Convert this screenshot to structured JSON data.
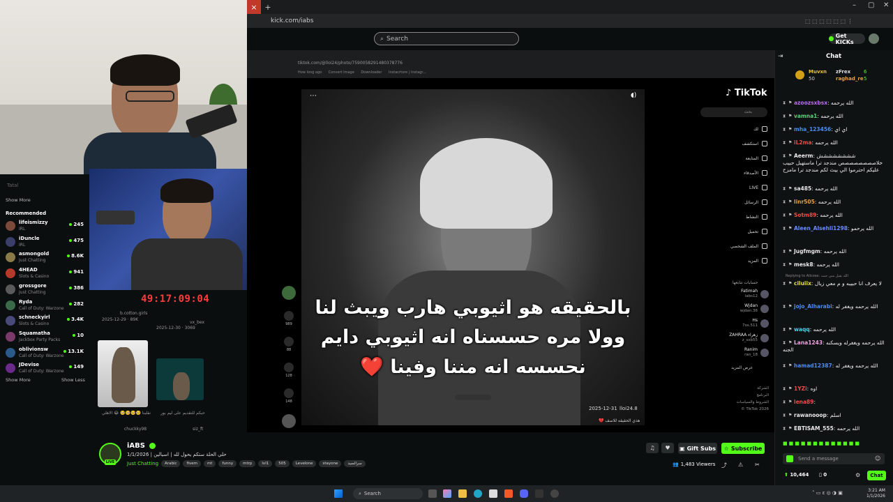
{
  "browser": {
    "url": "kick.com/iabs",
    "inner_url": "tiktok.com/@lloi24/photo/7590058291480378776",
    "bookmarks": [
      "How long ago",
      "Convert Image",
      "Downloader",
      "Instacrtore | Instagr..."
    ]
  },
  "kick_header": {
    "search_placeholder": "Search",
    "get_kicks_label": "Get KICKs"
  },
  "sidebar": {
    "top_item": "Tatal",
    "show_more_1": "Show More",
    "recommended_label": "Recommended",
    "recommended": [
      {
        "name": "lifeismizzy",
        "category": "IRL",
        "viewers": "245",
        "color": "#7a4b3a"
      },
      {
        "name": "iDuncle",
        "category": "IRL",
        "viewers": "475",
        "color": "#3a3f6a"
      },
      {
        "name": "asmongold",
        "category": "Just Chatting",
        "viewers": "8.6K",
        "color": "#8a7a4a"
      },
      {
        "name": "4HEAD",
        "category": "Slots & Casino",
        "viewers": "941",
        "color": "#b63a2a"
      },
      {
        "name": "grossgore",
        "category": "Just Chatting",
        "viewers": "386",
        "color": "#5a5a5a"
      },
      {
        "name": "Ryda",
        "category": "Call of Duty: Warzone",
        "viewers": "282",
        "color": "#3a6a4a"
      },
      {
        "name": "schneckyirl",
        "category": "Slots & Casino",
        "viewers": "3.4K",
        "color": "#4a4a7a"
      },
      {
        "name": "Squamatha",
        "category": "Jackbox Party Packs",
        "viewers": "10",
        "color": "#7a3a6a"
      },
      {
        "name": "oblivionsw",
        "category": "Call of Duty: Warzone",
        "viewers": "13.1K",
        "color": "#2a5a8a"
      },
      {
        "name": "JDevise",
        "category": "Call of Duty: Warzone",
        "viewers": "149",
        "color": "#6a2a8a"
      }
    ],
    "show_more_2": "Show More",
    "show_less": "Show Less"
  },
  "overlay": {
    "timer": "49:17:09:04"
  },
  "tiktok": {
    "logo": "TikTok",
    "search_placeholder": "بحث",
    "nav": [
      "لك",
      "استكشف",
      "المتابعة",
      "الأصدقاء",
      "LIVE",
      "الرسائل",
      "النشاط",
      "تحميل",
      "الملف الشخصي",
      "المزيد"
    ],
    "following_label": "حسابات تتابعها",
    "following": [
      {
        "name": "Fatimah",
        "handle": "iabs12"
      },
      {
        "name": "Wjdan",
        "handle": "wjdan.36"
      },
      {
        "name": "Hs",
        "handle": "7os.511"
      },
      {
        "name": "ZAHRAA زهراء",
        "handle": "z_sxb55"
      },
      {
        "name": "Ranim",
        "handle": "ran_18"
      }
    ],
    "see_more": "عرض المزيد",
    "footer": [
      "الشركة",
      "البرنامج",
      "الشروط والسياسات",
      "TikTok 2026 ©"
    ],
    "subtitle_lines": [
      "بالحقيقه هو اثيوبي هارب ويبث لنا",
      "وولا مره حسسناه انه اثيوبي دايم",
      "نحسسه انه مننا وفينا ❤️"
    ],
    "video_date": "2025-12-31",
    "video_author": "lloi24.8",
    "video_caption": "هذي الحقيقه للاسف 💔",
    "actions": [
      {
        "icon": "heart-icon",
        "count": "989"
      },
      {
        "icon": "comment-icon",
        "count": "88"
      },
      {
        "icon": "bookmark-icon",
        "count": "128"
      },
      {
        "icon": "share-icon",
        "count": "148"
      }
    ],
    "grid_meta_1": "b.cotton.girls",
    "grid_meta_2": "2025-12-29 · 89K",
    "grid_meta_3": "vx_bex",
    "grid_meta_4": "2025-12-30 · 3069",
    "grid_meta_5": "chuckky98",
    "grid_meta_6": "siz_ft",
    "grid_caption_1": "انقلبنا 🥺🥺🥺🥺 😂 الاهلي...",
    "grid_caption_2": "مشترين السعودية 💚 حبكم للتقديم على ليم بور..."
  },
  "stream": {
    "name": "iABS",
    "title": "حلي الحلة ستكم يحول لله | اسيالين | 1/1/2026",
    "category": "Just Chatting",
    "tags": [
      "Arabic",
      "fivem",
      "mt",
      "funny",
      "mtrp",
      "lvl1",
      "505",
      "Levelone",
      "stayone",
      "سرالسيد"
    ],
    "gift_subs_label": "Gift Subs",
    "subscribe_label": "Subscribe",
    "viewers": "1,483 Viewers"
  },
  "chat": {
    "title": "Chat",
    "gifters": [
      {
        "name": "Muvxn",
        "count": "50"
      },
      {
        "name": "zFrex",
        "count": "6"
      },
      {
        "name": "raghad_re",
        "count": "5"
      }
    ],
    "messages": [
      {
        "user": "azoozsxbsx",
        "color": "#b86cf0",
        "text": "الله يرحمه"
      },
      {
        "user": "vamna1",
        "color": "#5ad07a",
        "text": "الله يرحمه"
      },
      {
        "user": "mha_123456",
        "color": "#4a8cf0",
        "text": "اي اي"
      },
      {
        "user": "iL2ma",
        "color": "#f04a4a",
        "text": "الله يرحمه"
      },
      {
        "user": "Aeerm",
        "color": "#e8e8e8",
        "text": "شششششششش خلاصصصصصصصص مندجد ترا ماستهبل حبيب عليكم احترموا الي بيث لكم مندجد ترا مامزح"
      },
      {
        "user": "sa485",
        "color": "#e8e8e8",
        "text": "الله يرحمه"
      },
      {
        "user": "linr505",
        "color": "#e8a040",
        "text": "الله يرحمه"
      },
      {
        "user": "Sotm89",
        "color": "#f04a4a",
        "text": "الله يرحمه"
      },
      {
        "user": "Aleen_Alsehli1298",
        "color": "#6a8cff",
        "text": "الله يرحمو"
      },
      {
        "user": "Jugfmgm",
        "color": "#e8e8e8",
        "text": "الله يرحمه"
      },
      {
        "user": "mesk8",
        "color": "#e8e8e8",
        "text": "الله يرحمه"
      },
      {
        "user": "ciluiix",
        "color": "#e8e040",
        "text": "لا يعرف انا حبيبه و م معي زيال"
      },
      {
        "user": "jojo_Alharabi",
        "color": "#4a8cf0",
        "text": "الله يرحمه ويغفر له"
      },
      {
        "user": "waqq",
        "color": "#4ad0f0",
        "text": "الله يرحمه"
      },
      {
        "user": "Lana1243",
        "color": "#f0a0e0",
        "text": "الله يرحمه ويغفرله ويسكنه الجنه"
      },
      {
        "user": "hamad12387",
        "color": "#4a8cf0",
        "text": "الله يرحمه ويغفر له"
      },
      {
        "user": "1YZi",
        "color": "#f04a4a",
        "text": "اوه"
      },
      {
        "user": "lena89",
        "color": "#f04a4a",
        "text": ""
      },
      {
        "user": "rawanooop",
        "color": "#e8e8e8",
        "text": "اسلم"
      },
      {
        "user": "EBTISAM_555",
        "color": "#e8e8e8",
        "text": "الله يرحمه"
      }
    ],
    "replying_to": "Replying to Alicose: الله يقبل مني جبت",
    "send_placeholder": "Send a message",
    "points": "10,464",
    "zero": "0",
    "chat_button": "Chat"
  },
  "taskbar": {
    "search_label": "Search",
    "time": "3:21 AM",
    "date": "1/1/2026"
  }
}
